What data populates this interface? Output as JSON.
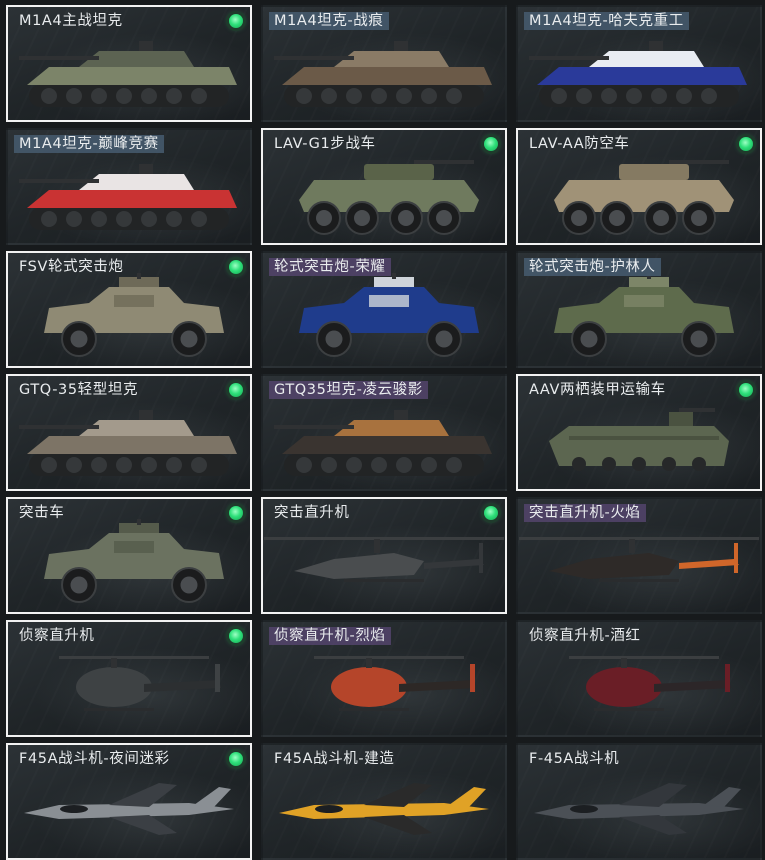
{
  "colors": {
    "owned_border": "#f2f2f2",
    "owned_dot": "#2ee07a",
    "tag_blue": "#465c70",
    "tag_purple": "#54446c"
  },
  "cards": [
    {
      "label": "M1A4主战坦克",
      "owned": true,
      "tag": "plain",
      "kind": "tank",
      "icon": "tank-icon",
      "body": "#7c8469",
      "accent": "#5c6352"
    },
    {
      "label": "M1A4坦克-战痕",
      "owned": false,
      "tag": "blue",
      "kind": "tank",
      "icon": "tank-icon",
      "body": "#6b5a48",
      "accent": "#8a7b66"
    },
    {
      "label": "M1A4坦克-哈夫克重工",
      "owned": false,
      "tag": "blue",
      "kind": "tank",
      "icon": "tank-icon",
      "body": "#2a3a9a",
      "accent": "#e8ecf2"
    },
    {
      "label": "M1A4坦克-巅峰竞赛",
      "owned": false,
      "tag": "blue",
      "kind": "tank",
      "icon": "tank-icon",
      "body": "#c93333",
      "accent": "#e9e4e4"
    },
    {
      "label": "LAV-G1步战车",
      "owned": true,
      "tag": "plain",
      "kind": "wheeled8",
      "icon": "ifv-icon",
      "body": "#6f7a5e",
      "accent": "#5a6349"
    },
    {
      "label": "LAV-AA防空车",
      "owned": true,
      "tag": "plain",
      "kind": "wheeled8",
      "icon": "aa-vehicle-icon",
      "body": "#a09277",
      "accent": "#857a62"
    },
    {
      "label": "FSV轮式突击炮",
      "owned": true,
      "tag": "plain",
      "kind": "wheeled4",
      "icon": "assault-gun-icon",
      "body": "#8f8a74",
      "accent": "#6e6a58"
    },
    {
      "label": "轮式突击炮-荣耀",
      "owned": false,
      "tag": "purple",
      "kind": "wheeled4",
      "icon": "assault-gun-icon",
      "body": "#1f3c8c",
      "accent": "#cfd4da"
    },
    {
      "label": "轮式突击炮-护林人",
      "owned": false,
      "tag": "blue",
      "kind": "wheeled4",
      "icon": "assault-gun-icon",
      "body": "#5e6b4c",
      "accent": "#7d8668"
    },
    {
      "label": "GTQ-35轻型坦克",
      "owned": true,
      "tag": "plain",
      "kind": "tank",
      "icon": "light-tank-icon",
      "body": "#7d7466",
      "accent": "#a39a8c"
    },
    {
      "label": "GTQ35坦克-凌云骏影",
      "owned": false,
      "tag": "purple",
      "kind": "tank",
      "icon": "light-tank-icon",
      "body": "#3a3430",
      "accent": "#a8723e"
    },
    {
      "label": "AAV两栖装甲运输车",
      "owned": true,
      "tag": "plain",
      "kind": "amphib",
      "icon": "amphibious-icon",
      "body": "#5c6650",
      "accent": "#4a5240"
    },
    {
      "label": "突击车",
      "owned": true,
      "tag": "plain",
      "kind": "wheeled4",
      "icon": "assault-vehicle-icon",
      "body": "#6b7260",
      "accent": "#555b4b"
    },
    {
      "label": "突击直升机",
      "owned": true,
      "tag": "plain",
      "kind": "heli",
      "icon": "attack-helicopter-icon",
      "body": "#4a4d4f",
      "accent": "#34373a"
    },
    {
      "label": "突击直升机-火焰",
      "owned": false,
      "tag": "purple",
      "kind": "heli",
      "icon": "attack-helicopter-icon",
      "body": "#2e2a28",
      "accent": "#d0662a"
    },
    {
      "label": "侦察直升机",
      "owned": true,
      "tag": "plain",
      "kind": "scout",
      "icon": "scout-helicopter-icon",
      "body": "#3e4244",
      "accent": "#2c2f31"
    },
    {
      "label": "侦察直升机-烈焰",
      "owned": false,
      "tag": "purple",
      "kind": "scout",
      "icon": "scout-helicopter-icon",
      "body": "#b5452a",
      "accent": "#2d2826"
    },
    {
      "label": "侦察直升机-酒红",
      "owned": false,
      "tag": "plain",
      "kind": "scout",
      "icon": "scout-helicopter-icon",
      "body": "#6a1e26",
      "accent": "#2c2628"
    },
    {
      "label": "F45A战斗机-夜间迷彩",
      "owned": true,
      "tag": "plain",
      "kind": "jet",
      "icon": "fighter-jet-icon",
      "body": "#8a8f94",
      "accent": "#3b3f44"
    },
    {
      "label": "F45A战斗机-建造",
      "owned": false,
      "tag": "plain",
      "kind": "jet",
      "icon": "fighter-jet-icon",
      "body": "#e0a226",
      "accent": "#2a2a2a"
    },
    {
      "label": "F-45A战斗机",
      "owned": false,
      "tag": "plain",
      "kind": "jet",
      "icon": "fighter-jet-icon",
      "body": "#4b5056",
      "accent": "#33373c"
    }
  ]
}
